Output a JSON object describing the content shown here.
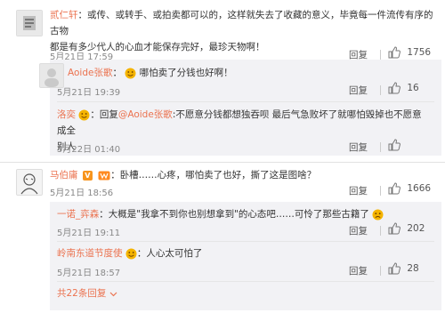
{
  "comments": [
    {
      "user": "贰仁轩",
      "sep": "：",
      "text_line1": "或传、或转手、或拍卖都可以的，这样就失去了收藏的意义，毕竟每一件流传有序的古物",
      "text_line2": "都是有多少代人的心血才能保存完好，最珍天物啊！",
      "time": "5月21日 17:59",
      "reply_label": "回复",
      "likes": "1756"
    },
    {
      "user": "Aoide张歌",
      "sep": "：",
      "text": "哪怕卖了分钱也好啊！",
      "time": "5月21日 19:39",
      "reply_label": "回复",
      "likes": "16"
    },
    {
      "user": "洛奕",
      "text_prefix": "：回复",
      "mention": "@Aoide张歌",
      "text_line1": ":不愿意分钱都想独吞呗 最后气急败坏了就哪怕毁掉也不愿意成全",
      "text_line2": "别人",
      "time": "5月22日 01:40",
      "reply_label": "回复",
      "likes": ""
    },
    {
      "user": "马伯庸",
      "sep": "：",
      "text": "卧槽……心疼，哪怕卖了也好，撕了这是图啥？",
      "time": "5月21日 18:56",
      "reply_label": "回复",
      "likes": "1666"
    },
    {
      "user": "一诺_弈森",
      "sep": "：",
      "text": "大概是\"我拿不到你也别想拿到\"的心态吧……可怜了那些古籍了",
      "time": "5月21日 19:11",
      "reply_label": "回复",
      "likes": "202"
    },
    {
      "user": "岭南东道节度使",
      "sep": "：",
      "text": "人心太可怕了",
      "time": "5月21日 18:57",
      "reply_label": "回复",
      "likes": "28"
    }
  ],
  "more_replies": "共22条回复",
  "colors": {
    "link": "#eb7350",
    "meta": "#888888",
    "reply_bg": "#f2f2f5"
  },
  "icons": [
    "thumbs-up-icon",
    "v-badge-icon",
    "member-icon",
    "smile-emoji-icon",
    "chevron-down-icon"
  ]
}
